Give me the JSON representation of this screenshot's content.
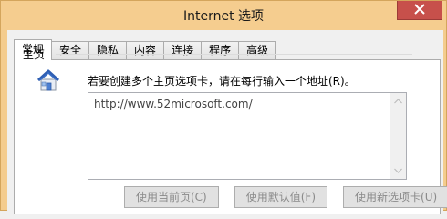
{
  "window": {
    "title": "Internet 选项"
  },
  "tabs": [
    {
      "label": "常规",
      "active": true
    },
    {
      "label": "安全",
      "active": false
    },
    {
      "label": "隐私",
      "active": false
    },
    {
      "label": "内容",
      "active": false
    },
    {
      "label": "连接",
      "active": false
    },
    {
      "label": "程序",
      "active": false
    },
    {
      "label": "高级",
      "active": false
    }
  ],
  "home_section": {
    "label": "主页",
    "icon": "home-icon",
    "instruction": "若要创建多个主页选项卡，请在每行输入一个地址(R)。",
    "url_value": "http://www.52microsoft.com/"
  },
  "buttons": {
    "use_current": "使用当前页(C)",
    "use_default": "使用默认值(F)",
    "use_new_tab": "使用新选项卡(U)"
  },
  "colors": {
    "titlebar": "#f5cd8f",
    "close_button": "#c7504b",
    "panel_bg": "#ffffff"
  }
}
